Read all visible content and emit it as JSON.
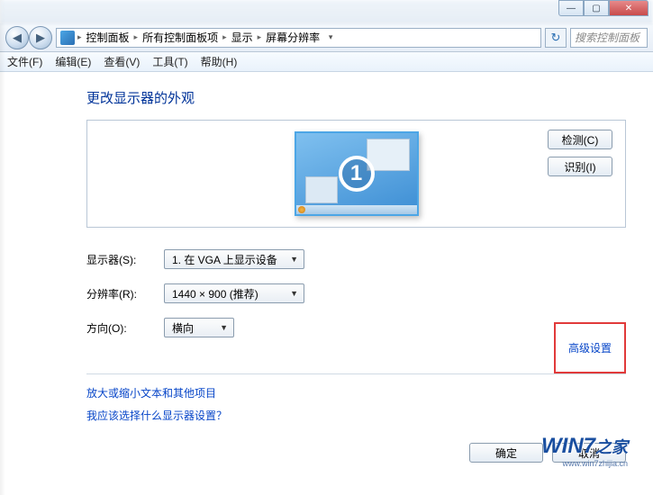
{
  "window": {
    "controls": {
      "min": "—",
      "max": "▢",
      "close": "✕"
    }
  },
  "nav": {
    "back_icon": "◀",
    "fwd_icon": "▶",
    "crumbs": [
      "控制面板",
      "所有控制面板项",
      "显示",
      "屏幕分辨率"
    ],
    "sep": "▸",
    "dropdown_icon": "▾",
    "refresh_icon": "↻",
    "search_placeholder": "搜索控制面板"
  },
  "menu": {
    "file": "文件(F)",
    "edit": "编辑(E)",
    "view": "查看(V)",
    "tools": "工具(T)",
    "help": "帮助(H)"
  },
  "heading": "更改显示器的外观",
  "preview": {
    "monitor_number": "1",
    "detect_btn": "检测(C)",
    "identify_btn": "识别(I)"
  },
  "form": {
    "display_label": "显示器(S):",
    "display_value": "1. 在 VGA 上显示设备",
    "resolution_label": "分辨率(R):",
    "resolution_value": "1440 × 900 (推荐)",
    "orientation_label": "方向(O):",
    "orientation_value": "横向",
    "combo_arrow": "▼"
  },
  "links": {
    "advanced": "高级设置",
    "text_size": "放大或缩小文本和其他项目",
    "help": "我应该选择什么显示器设置？"
  },
  "footer": {
    "ok": "确定",
    "cancel": "取消"
  },
  "watermark": {
    "brand": "WIN7",
    "suffix": "之家",
    "url": "www.win7zhijia.cn"
  }
}
